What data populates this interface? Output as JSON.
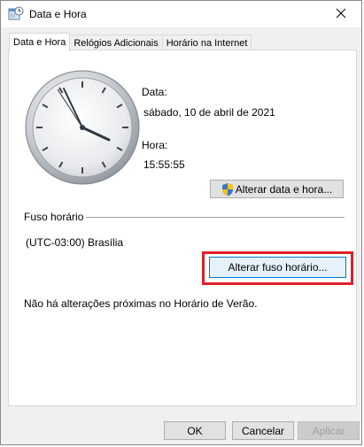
{
  "window": {
    "title": "Data e Hora",
    "title_icon": "clock-calendar-icon",
    "close_icon": "close-icon"
  },
  "tabs": [
    {
      "label": "Data e Hora",
      "active": true
    },
    {
      "label": "Relógios Adicionais",
      "active": false
    },
    {
      "label": "Horário na Internet",
      "active": false
    }
  ],
  "date_time": {
    "date_label": "Data:",
    "date_value": "sábado, 10 de abril de 2021",
    "time_label": "Hora:",
    "time_value": "15:55:55",
    "change_button": "Alterar data e hora...",
    "change_button_icon": "uac-shield-icon"
  },
  "timezone": {
    "group_label": "Fuso horário",
    "value": "(UTC-03:00) Brasília",
    "change_button": "Alterar fuso horário..."
  },
  "dst_message": "Não há alterações próximas no Horário de Verão.",
  "footer": {
    "ok": "OK",
    "cancel": "Cancelar",
    "apply": "Aplicar"
  },
  "colors": {
    "highlight": "#e0202a",
    "focus_border": "#0078d7"
  }
}
